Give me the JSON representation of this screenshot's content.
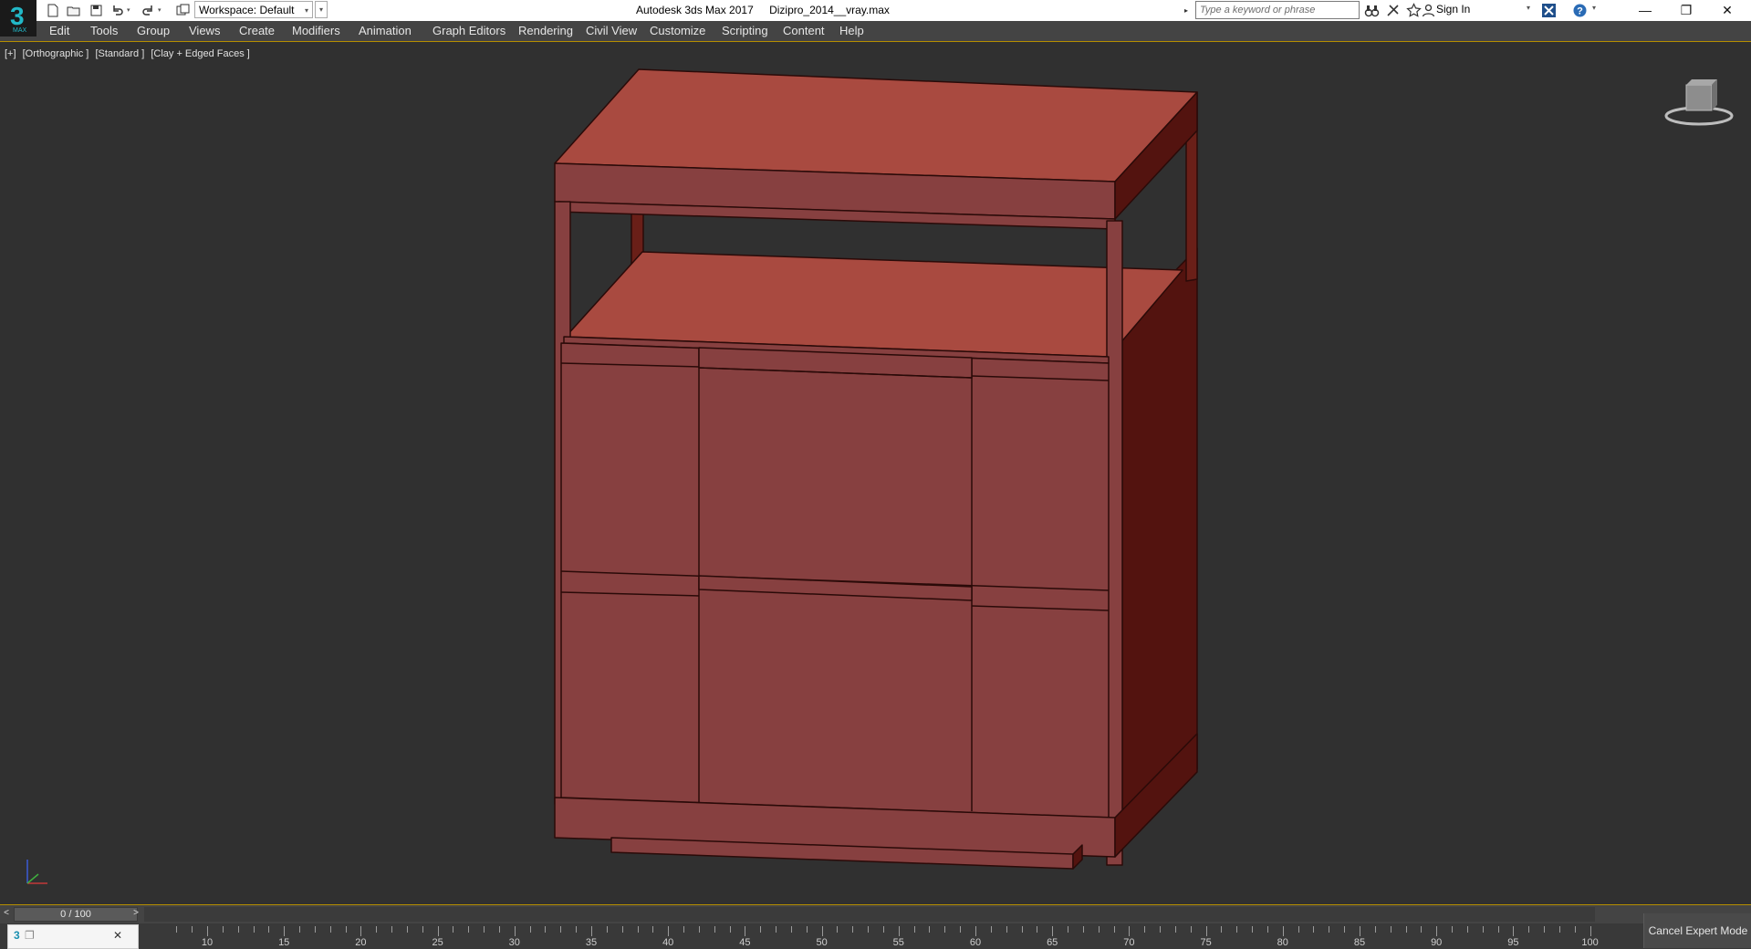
{
  "window": {
    "app_name": "Autodesk 3ds Max 2017",
    "file_name": "Dizipro_2014__vray.max",
    "logo_digit": "3",
    "logo_label": "MAX"
  },
  "quick_access": {
    "workspace_label": "Workspace: Default",
    "icons": [
      "new-file-icon",
      "open-file-icon",
      "save-icon",
      "undo-icon",
      "redo-icon",
      "project-folder-icon"
    ]
  },
  "search": {
    "placeholder": "Type a keyword or phrase"
  },
  "account": {
    "sign_in_label": "Sign In"
  },
  "menu": {
    "items": [
      "Edit",
      "Tools",
      "Group",
      "Views",
      "Create",
      "Modifiers",
      "Animation",
      "Graph Editors",
      "Rendering",
      "Civil View",
      "Customize",
      "Scripting",
      "Content",
      "Help"
    ]
  },
  "viewport": {
    "label_plus": "[+]",
    "label_view": "[Orthographic ]",
    "label_shading": "[Standard ]",
    "label_style": "[Clay + Edged Faces ]",
    "colors": {
      "background": "#303030",
      "model_front": "#874040",
      "model_top": "#a94a40",
      "model_side": "#53130f",
      "edge": "#2a0a08"
    }
  },
  "time_slider": {
    "value": "0 / 100",
    "prev_label": "<",
    "next_label": ">"
  },
  "track_bar": {
    "ticks": [
      "10",
      "15",
      "20",
      "25",
      "30",
      "35",
      "40",
      "45",
      "50",
      "55",
      "60",
      "65",
      "70",
      "75",
      "80",
      "85",
      "90",
      "95",
      "100"
    ]
  },
  "status": {
    "cancel_expert_label": "Cancel Expert Mode"
  }
}
